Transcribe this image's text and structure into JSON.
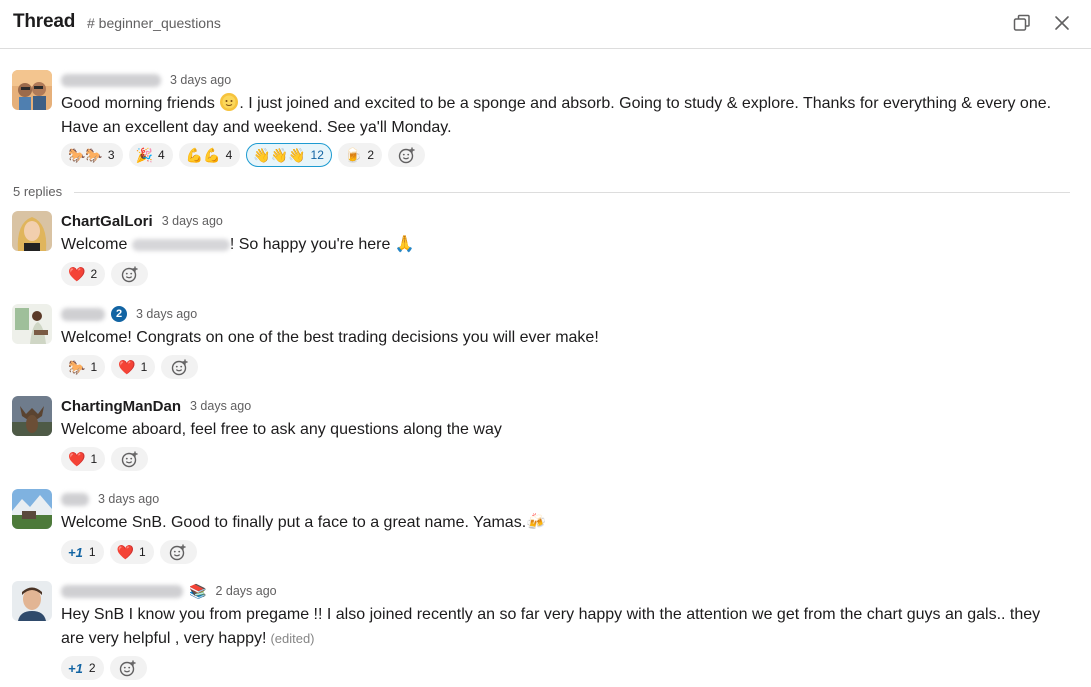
{
  "header": {
    "title": "Thread",
    "channel": "# beginner_questions"
  },
  "replies_label": "5 replies",
  "messages": [
    {
      "author": "",
      "timestamp": "3 days ago",
      "text_1": "Good morning friends ",
      "text_2": ". I just joined and excited to be a sponge and absorb. Going to study & explore. Thanks for everything & every one.",
      "text_3": "Have an excellent day and weekend. See ya'll Monday.",
      "reactions": [
        {
          "emoji": "🐎🐎",
          "count": "3"
        },
        {
          "emoji": "🎉",
          "count": "4"
        },
        {
          "emoji": "💪💪",
          "count": "4"
        },
        {
          "emoji": "👋👋👋",
          "count": "12"
        },
        {
          "emoji": "🍺",
          "count": "2"
        }
      ]
    },
    {
      "author": "ChartGalLori",
      "timestamp": "3 days ago",
      "text_1": "Welcome ",
      "text_2": "! So happy you're here ",
      "emoji": "🙏",
      "reactions": [
        {
          "emoji": "❤️",
          "count": "2"
        }
      ]
    },
    {
      "author": "",
      "badge": "2",
      "timestamp": "3 days ago",
      "text": "Welcome!  Congrats on one of the best trading decisions  you will ever make!",
      "reactions": [
        {
          "emoji": "🐎",
          "count": "1"
        },
        {
          "emoji": "❤️",
          "count": "1"
        }
      ]
    },
    {
      "author": "ChartingManDan",
      "timestamp": "3 days ago",
      "text": "Welcome aboard, feel free to ask any questions along the way",
      "reactions": [
        {
          "emoji": "❤️",
          "count": "1"
        }
      ]
    },
    {
      "author": "",
      "timestamp": "3 days ago",
      "text": "Welcome SnB. Good to finally put a face to a great name. Yamas.",
      "emoji": "🍻",
      "reactions": [
        {
          "label": "+1",
          "count": "1"
        },
        {
          "emoji": "❤️",
          "count": "1"
        }
      ]
    },
    {
      "author": "",
      "author_emoji": "📚",
      "timestamp": "2 days ago",
      "text_1": "Hey SnB I know you from pregame !! I also joined recently an so far very happy with the attention we get from the chart guys an gals.. they",
      "text_2": "are very helpful , very happy!",
      "edited": "(edited)",
      "reactions": [
        {
          "label": "+1",
          "count": "2"
        }
      ]
    }
  ],
  "icons": {
    "popout": "popout-window-icon",
    "close": "close-icon",
    "add_reaction": "add-reaction-icon",
    "sun": "sun-emoji"
  },
  "colors": {
    "link_blue": "#1264a3",
    "active_reaction_bg": "#e8f5fa",
    "active_reaction_border": "#1d9bd1"
  }
}
